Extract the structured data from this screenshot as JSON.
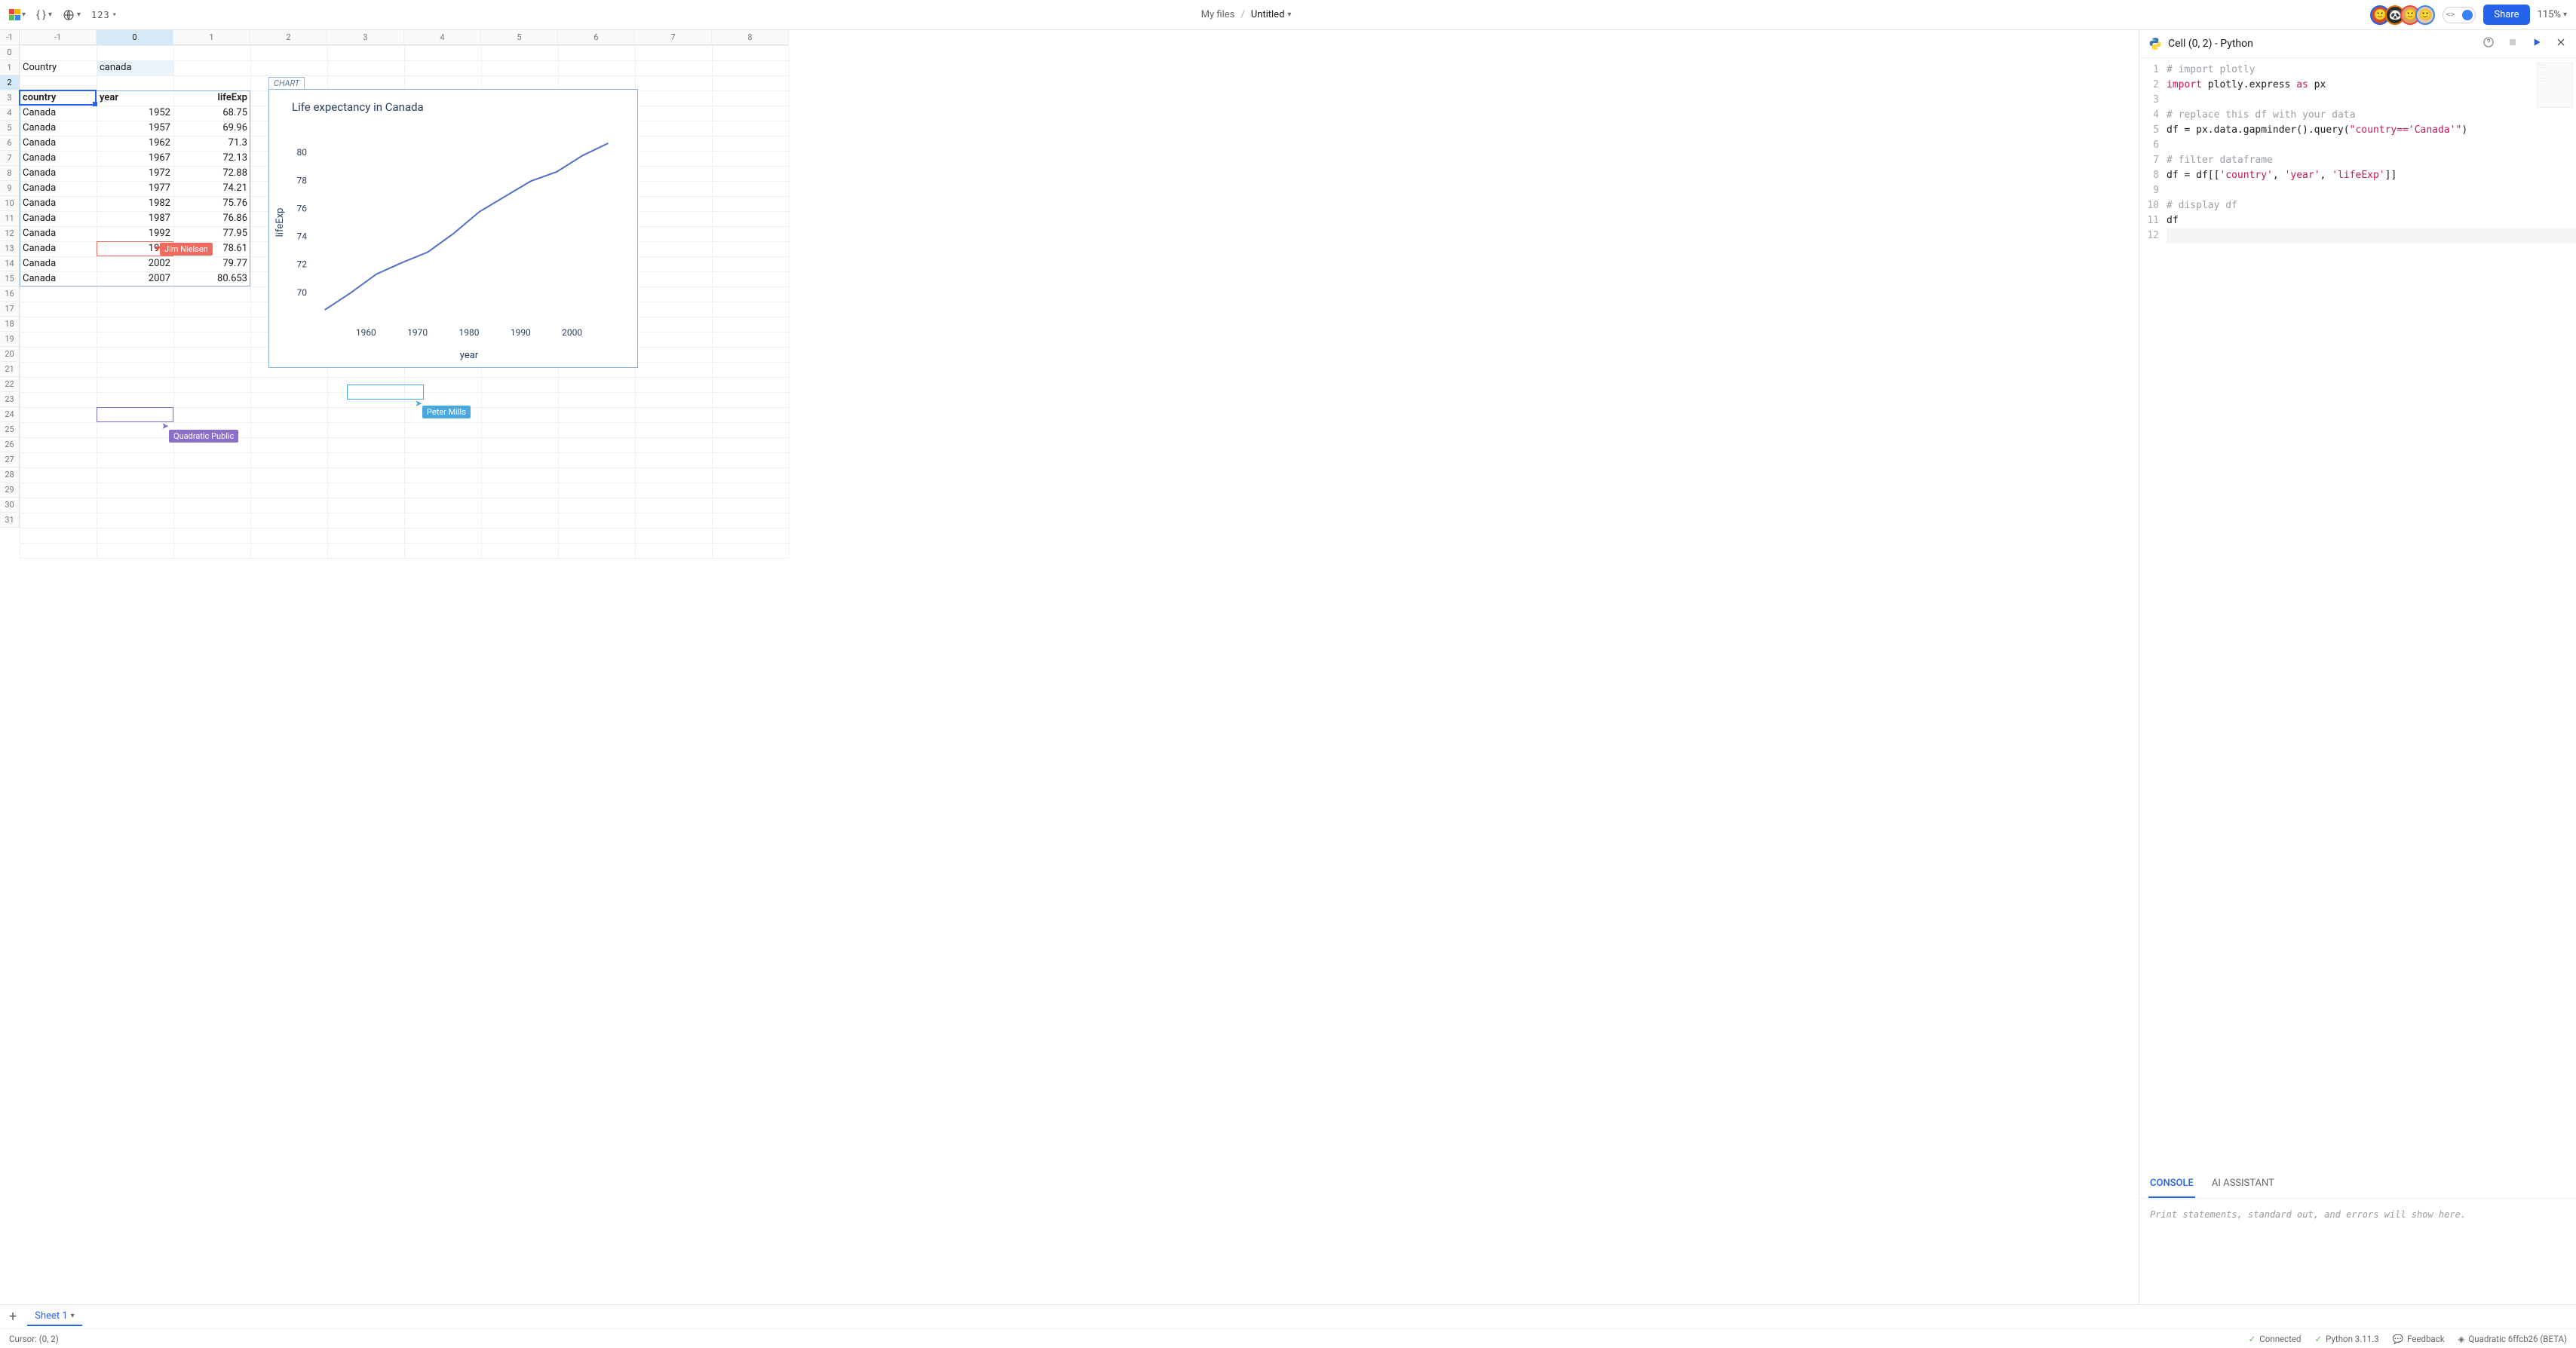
{
  "topbar": {
    "number_format": "123",
    "breadcrumb_root": "My files",
    "file_name": "Untitled",
    "share_label": "Share",
    "zoom": "115%"
  },
  "avatars": [
    {
      "bg": "#c94f2e",
      "ring": "#2563eb"
    },
    {
      "bg": "#2a2a2a",
      "ring": "#d97706"
    },
    {
      "bg": "#d9a066",
      "ring": "#ef4444"
    },
    {
      "bg": "#e0c9a6",
      "ring": "#3b82f6"
    }
  ],
  "columns": [
    -1,
    0,
    1,
    2,
    3,
    4,
    5,
    6,
    7,
    8
  ],
  "rows": [
    -1,
    0,
    1,
    2,
    3,
    4,
    5,
    6,
    7,
    8,
    9,
    10,
    11,
    12,
    13,
    14,
    15,
    16,
    17,
    18,
    19,
    20,
    21,
    22,
    23,
    24,
    25,
    26,
    27,
    28,
    29,
    30,
    31
  ],
  "cells": {
    "input_label": "Country",
    "input_value": "canada",
    "headers": [
      "country",
      "year",
      "lifeExp"
    ],
    "data": [
      [
        "Canada",
        "1952",
        "68.75"
      ],
      [
        "Canada",
        "1957",
        "69.96"
      ],
      [
        "Canada",
        "1962",
        "71.3"
      ],
      [
        "Canada",
        "1967",
        "72.13"
      ],
      [
        "Canada",
        "1972",
        "72.88"
      ],
      [
        "Canada",
        "1977",
        "74.21"
      ],
      [
        "Canada",
        "1982",
        "75.76"
      ],
      [
        "Canada",
        "1987",
        "76.86"
      ],
      [
        "Canada",
        "1992",
        "77.95"
      ],
      [
        "Canada",
        "1997",
        "78.61"
      ],
      [
        "Canada",
        "2002",
        "79.77"
      ],
      [
        "Canada",
        "2007",
        "80.653"
      ]
    ]
  },
  "chart_data": {
    "type": "line",
    "badge": "CHART",
    "title": "Life expectancy in Canada",
    "xlabel": "year",
    "ylabel": "lifeExp",
    "x": [
      1952,
      1957,
      1962,
      1967,
      1972,
      1977,
      1982,
      1987,
      1992,
      1997,
      2002,
      2007
    ],
    "y": [
      68.75,
      69.96,
      71.3,
      72.13,
      72.88,
      74.21,
      75.76,
      76.86,
      77.95,
      78.61,
      79.77,
      80.653
    ],
    "xticks": [
      1960,
      1970,
      1980,
      1990,
      2000
    ],
    "yticks": [
      70,
      72,
      74,
      76,
      78,
      80
    ],
    "xlim": [
      1950,
      2010
    ],
    "ylim": [
      68,
      82
    ]
  },
  "presence": {
    "jim": {
      "name": "Jim Nielsen",
      "color": "#ef6b5f"
    },
    "peter": {
      "name": "Peter Mills",
      "color": "#4aa8e0"
    },
    "quadratic": {
      "name": "Quadratic Public",
      "color": "#8b6fc9"
    }
  },
  "code_panel": {
    "title": "Cell (0, 2) - Python",
    "lines": [
      {
        "n": 1,
        "t": "comment",
        "text": "# import plotly"
      },
      {
        "n": 2,
        "t": "code",
        "text": "import plotly.express as px"
      },
      {
        "n": 3,
        "t": "blank",
        "text": ""
      },
      {
        "n": 4,
        "t": "comment",
        "text": "# replace this df with your data"
      },
      {
        "n": 5,
        "t": "code",
        "text": "df = px.data.gapminder().query(\"country=='Canada'\")"
      },
      {
        "n": 6,
        "t": "blank",
        "text": ""
      },
      {
        "n": 7,
        "t": "comment",
        "text": "# filter dataframe"
      },
      {
        "n": 8,
        "t": "code",
        "text": "df = df[['country', 'year', 'lifeExp']]"
      },
      {
        "n": 9,
        "t": "blank",
        "text": ""
      },
      {
        "n": 10,
        "t": "comment",
        "text": "# display df"
      },
      {
        "n": 11,
        "t": "code",
        "text": "df"
      },
      {
        "n": 12,
        "t": "blank",
        "text": ""
      }
    ],
    "tabs": {
      "console": "CONSOLE",
      "ai": "AI ASSISTANT"
    },
    "console_placeholder": "Print statements, standard out, and errors will show here."
  },
  "sheet_tab": "Sheet 1",
  "statusbar": {
    "cursor": "Cursor: (0, 2)",
    "connected": "Connected",
    "python": "Python 3.11.3",
    "feedback": "Feedback",
    "build": "Quadratic 6ffcb26 (BETA)"
  }
}
